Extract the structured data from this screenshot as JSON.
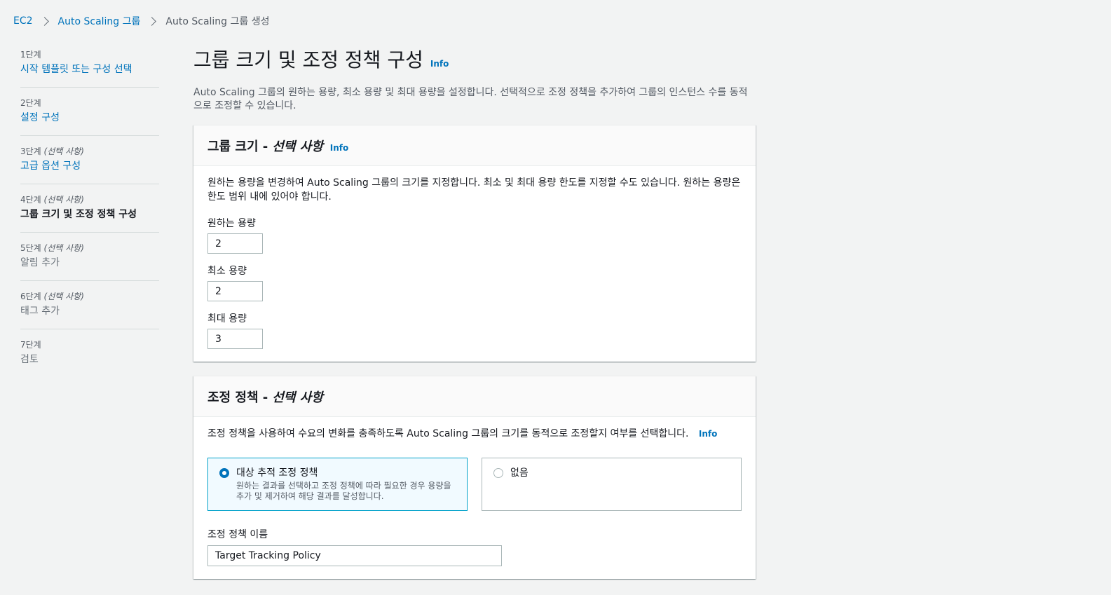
{
  "breadcrumb": {
    "items": [
      "EC2",
      "Auto Scaling 그룹"
    ],
    "current": "Auto Scaling 그룹 생성"
  },
  "steps": [
    {
      "num": "1단계",
      "optional": "",
      "title": "시작 템플릿 또는 구성 선택",
      "state": "link"
    },
    {
      "num": "2단계",
      "optional": "",
      "title": "설정 구성",
      "state": "link"
    },
    {
      "num": "3단계",
      "optional": "(선택 사항)",
      "title": "고급 옵션 구성",
      "state": "link"
    },
    {
      "num": "4단계",
      "optional": "(선택 사항)",
      "title": "그룹 크기 및 조정 정책 구성",
      "state": "active"
    },
    {
      "num": "5단계",
      "optional": "(선택 사항)",
      "title": "알림 추가",
      "state": "disabled"
    },
    {
      "num": "6단계",
      "optional": "(선택 사항)",
      "title": "태그 추가",
      "state": "disabled"
    },
    {
      "num": "7단계",
      "optional": "",
      "title": "검토",
      "state": "disabled"
    }
  ],
  "page": {
    "title": "그룹 크기 및 조정 정책 구성",
    "info": "Info",
    "description": "Auto Scaling 그룹의 원하는 용량, 최소 용량 및 최대 용량을 설정합니다. 선택적으로 조정 정책을 추가하여 그룹의 인스턴스 수를 동적으로 조정할 수 있습니다."
  },
  "group_size": {
    "title": "그룹 크기 -",
    "title_optional": "선택 사항",
    "info": "Info",
    "description": "원하는 용량을 변경하여 Auto Scaling 그룹의 크기를 지정합니다. 최소 및 최대 용량 한도를 지정할 수도 있습니다. 원하는 용량은 한도 범위 내에 있어야 합니다.",
    "desired_label": "원하는 용량",
    "desired_value": "2",
    "min_label": "최소 용량",
    "min_value": "2",
    "max_label": "최대 용량",
    "max_value": "3"
  },
  "scaling_policy": {
    "title": "조정 정책 -",
    "title_optional": "선택 사항",
    "description": "조정 정책을 사용하여 수요의 변화를 충족하도록 Auto Scaling 그룹의 크기를 동적으로 조정할지 여부를 선택합니다.",
    "info": "Info",
    "option_target_title": "대상 추적 조정 정책",
    "option_target_desc": "원하는 결과를 선택하고 조정 정책에 따라 필요한 경우 용량을 추가 및 제거하여 해당 결과를 달성합니다.",
    "option_none_title": "없음",
    "name_label": "조정 정책 이름",
    "name_value": "Target Tracking Policy"
  }
}
